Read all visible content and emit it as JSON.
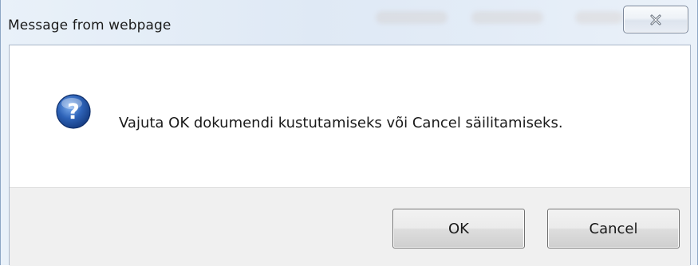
{
  "window": {
    "title": "Message from webpage"
  },
  "icons": {
    "close": "close-icon",
    "question": "question-icon"
  },
  "message": {
    "text": "Vajuta OK dokumendi kustutamiseks või Cancel säilitamiseks."
  },
  "buttons": {
    "ok_label": "OK",
    "cancel_label": "Cancel"
  },
  "colors": {
    "question_icon": "#2e63b8",
    "button_bar": "#f0f0f0"
  }
}
